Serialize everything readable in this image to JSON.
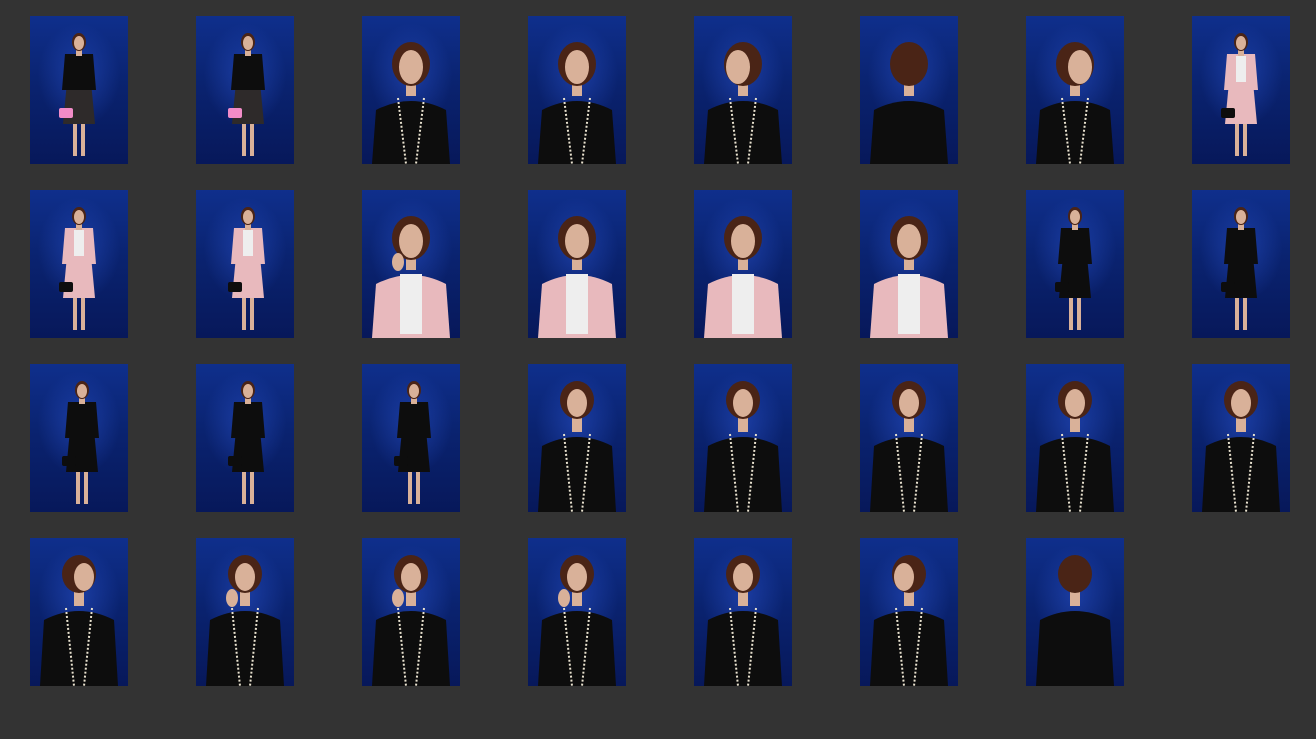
{
  "gallery": {
    "colors": {
      "background": "#333333",
      "backdrop": "#0a2370",
      "skin": "#d9b199",
      "hair": "#4a2416",
      "black_outfit": "#0d0d0d",
      "pink_jacket": "#e8b9bd",
      "white_top": "#eeeeee",
      "pink_bag": "#f28cc8",
      "floral_dress": "#2e2a2a",
      "pearl_trim": "#e9e2cf"
    },
    "rows": [
      [
        {
          "pose": "full-body",
          "outfit": "floral-dress-pink-bag"
        },
        {
          "pose": "full-body-turn",
          "outfit": "floral-dress-pink-bag"
        },
        {
          "pose": "half-body",
          "outfit": "black-cardigan-floral"
        },
        {
          "pose": "three-quarter-left",
          "outfit": "black-cardigan"
        },
        {
          "pose": "profile-right",
          "outfit": "black-cardigan"
        },
        {
          "pose": "back-of-head",
          "outfit": "black-cardigan"
        },
        {
          "pose": "profile-left",
          "outfit": "black-cardigan"
        },
        {
          "pose": "full-body",
          "outfit": "pink-jacket-skirt"
        }
      ],
      [
        {
          "pose": "full-body",
          "outfit": "pink-jacket-skirt"
        },
        {
          "pose": "full-body-turn",
          "outfit": "pink-jacket-skirt"
        },
        {
          "pose": "close-hand-face",
          "outfit": "pink-jacket-white-top"
        },
        {
          "pose": "half-body-turn",
          "outfit": "pink-jacket-white-top"
        },
        {
          "pose": "half-body-side",
          "outfit": "pink-jacket-white-top"
        },
        {
          "pose": "half-body-side",
          "outfit": "pink-jacket-white-top"
        },
        {
          "pose": "full-body",
          "outfit": "black-dress"
        },
        {
          "pose": "full-body",
          "outfit": "black-dress"
        }
      ],
      [
        {
          "pose": "full-body-side",
          "outfit": "black-dress"
        },
        {
          "pose": "full-body-side",
          "outfit": "black-dress"
        },
        {
          "pose": "full-body-back-turn",
          "outfit": "black-dress"
        },
        {
          "pose": "bust-turn",
          "outfit": "black-cardigan"
        },
        {
          "pose": "bust",
          "outfit": "black-cardigan"
        },
        {
          "pose": "bust",
          "outfit": "black-cardigan"
        },
        {
          "pose": "bust",
          "outfit": "black-cardigan"
        },
        {
          "pose": "bust-turn",
          "outfit": "black-cardigan"
        }
      ],
      [
        {
          "pose": "bust-profile-left",
          "outfit": "black-cardigan"
        },
        {
          "pose": "bust-hand-face",
          "outfit": "black-cardigan"
        },
        {
          "pose": "bust-hand-face",
          "outfit": "black-cardigan"
        },
        {
          "pose": "bust-hand-face",
          "outfit": "black-cardigan"
        },
        {
          "pose": "bust-front",
          "outfit": "black-cardigan"
        },
        {
          "pose": "bust-profile-right",
          "outfit": "black-cardigan"
        },
        {
          "pose": "bust-profile-left-back",
          "outfit": "black-cardigan"
        }
      ]
    ]
  }
}
